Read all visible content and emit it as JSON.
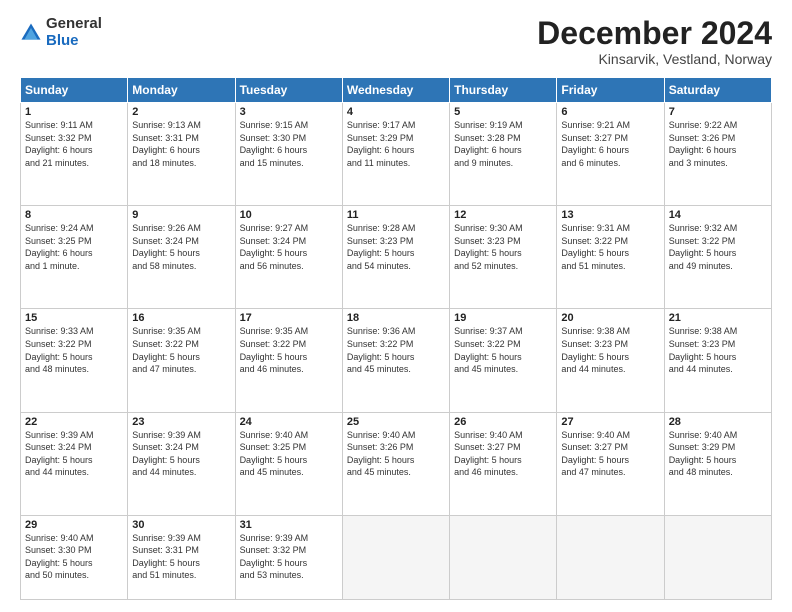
{
  "logo": {
    "general": "General",
    "blue": "Blue"
  },
  "header": {
    "month": "December 2024",
    "location": "Kinsarvik, Vestland, Norway"
  },
  "weekdays": [
    "Sunday",
    "Monday",
    "Tuesday",
    "Wednesday",
    "Thursday",
    "Friday",
    "Saturday"
  ],
  "weeks": [
    [
      {
        "day": "1",
        "info": "Sunrise: 9:11 AM\nSunset: 3:32 PM\nDaylight: 6 hours\nand 21 minutes."
      },
      {
        "day": "2",
        "info": "Sunrise: 9:13 AM\nSunset: 3:31 PM\nDaylight: 6 hours\nand 18 minutes."
      },
      {
        "day": "3",
        "info": "Sunrise: 9:15 AM\nSunset: 3:30 PM\nDaylight: 6 hours\nand 15 minutes."
      },
      {
        "day": "4",
        "info": "Sunrise: 9:17 AM\nSunset: 3:29 PM\nDaylight: 6 hours\nand 11 minutes."
      },
      {
        "day": "5",
        "info": "Sunrise: 9:19 AM\nSunset: 3:28 PM\nDaylight: 6 hours\nand 9 minutes."
      },
      {
        "day": "6",
        "info": "Sunrise: 9:21 AM\nSunset: 3:27 PM\nDaylight: 6 hours\nand 6 minutes."
      },
      {
        "day": "7",
        "info": "Sunrise: 9:22 AM\nSunset: 3:26 PM\nDaylight: 6 hours\nand 3 minutes."
      }
    ],
    [
      {
        "day": "8",
        "info": "Sunrise: 9:24 AM\nSunset: 3:25 PM\nDaylight: 6 hours\nand 1 minute."
      },
      {
        "day": "9",
        "info": "Sunrise: 9:26 AM\nSunset: 3:24 PM\nDaylight: 5 hours\nand 58 minutes."
      },
      {
        "day": "10",
        "info": "Sunrise: 9:27 AM\nSunset: 3:24 PM\nDaylight: 5 hours\nand 56 minutes."
      },
      {
        "day": "11",
        "info": "Sunrise: 9:28 AM\nSunset: 3:23 PM\nDaylight: 5 hours\nand 54 minutes."
      },
      {
        "day": "12",
        "info": "Sunrise: 9:30 AM\nSunset: 3:23 PM\nDaylight: 5 hours\nand 52 minutes."
      },
      {
        "day": "13",
        "info": "Sunrise: 9:31 AM\nSunset: 3:22 PM\nDaylight: 5 hours\nand 51 minutes."
      },
      {
        "day": "14",
        "info": "Sunrise: 9:32 AM\nSunset: 3:22 PM\nDaylight: 5 hours\nand 49 minutes."
      }
    ],
    [
      {
        "day": "15",
        "info": "Sunrise: 9:33 AM\nSunset: 3:22 PM\nDaylight: 5 hours\nand 48 minutes."
      },
      {
        "day": "16",
        "info": "Sunrise: 9:35 AM\nSunset: 3:22 PM\nDaylight: 5 hours\nand 47 minutes."
      },
      {
        "day": "17",
        "info": "Sunrise: 9:35 AM\nSunset: 3:22 PM\nDaylight: 5 hours\nand 46 minutes."
      },
      {
        "day": "18",
        "info": "Sunrise: 9:36 AM\nSunset: 3:22 PM\nDaylight: 5 hours\nand 45 minutes."
      },
      {
        "day": "19",
        "info": "Sunrise: 9:37 AM\nSunset: 3:22 PM\nDaylight: 5 hours\nand 45 minutes."
      },
      {
        "day": "20",
        "info": "Sunrise: 9:38 AM\nSunset: 3:23 PM\nDaylight: 5 hours\nand 44 minutes."
      },
      {
        "day": "21",
        "info": "Sunrise: 9:38 AM\nSunset: 3:23 PM\nDaylight: 5 hours\nand 44 minutes."
      }
    ],
    [
      {
        "day": "22",
        "info": "Sunrise: 9:39 AM\nSunset: 3:24 PM\nDaylight: 5 hours\nand 44 minutes."
      },
      {
        "day": "23",
        "info": "Sunrise: 9:39 AM\nSunset: 3:24 PM\nDaylight: 5 hours\nand 44 minutes."
      },
      {
        "day": "24",
        "info": "Sunrise: 9:40 AM\nSunset: 3:25 PM\nDaylight: 5 hours\nand 45 minutes."
      },
      {
        "day": "25",
        "info": "Sunrise: 9:40 AM\nSunset: 3:26 PM\nDaylight: 5 hours\nand 45 minutes."
      },
      {
        "day": "26",
        "info": "Sunrise: 9:40 AM\nSunset: 3:27 PM\nDaylight: 5 hours\nand 46 minutes."
      },
      {
        "day": "27",
        "info": "Sunrise: 9:40 AM\nSunset: 3:27 PM\nDaylight: 5 hours\nand 47 minutes."
      },
      {
        "day": "28",
        "info": "Sunrise: 9:40 AM\nSunset: 3:29 PM\nDaylight: 5 hours\nand 48 minutes."
      }
    ],
    [
      {
        "day": "29",
        "info": "Sunrise: 9:40 AM\nSunset: 3:30 PM\nDaylight: 5 hours\nand 50 minutes."
      },
      {
        "day": "30",
        "info": "Sunrise: 9:39 AM\nSunset: 3:31 PM\nDaylight: 5 hours\nand 51 minutes."
      },
      {
        "day": "31",
        "info": "Sunrise: 9:39 AM\nSunset: 3:32 PM\nDaylight: 5 hours\nand 53 minutes."
      },
      {
        "day": "",
        "info": ""
      },
      {
        "day": "",
        "info": ""
      },
      {
        "day": "",
        "info": ""
      },
      {
        "day": "",
        "info": ""
      }
    ]
  ]
}
